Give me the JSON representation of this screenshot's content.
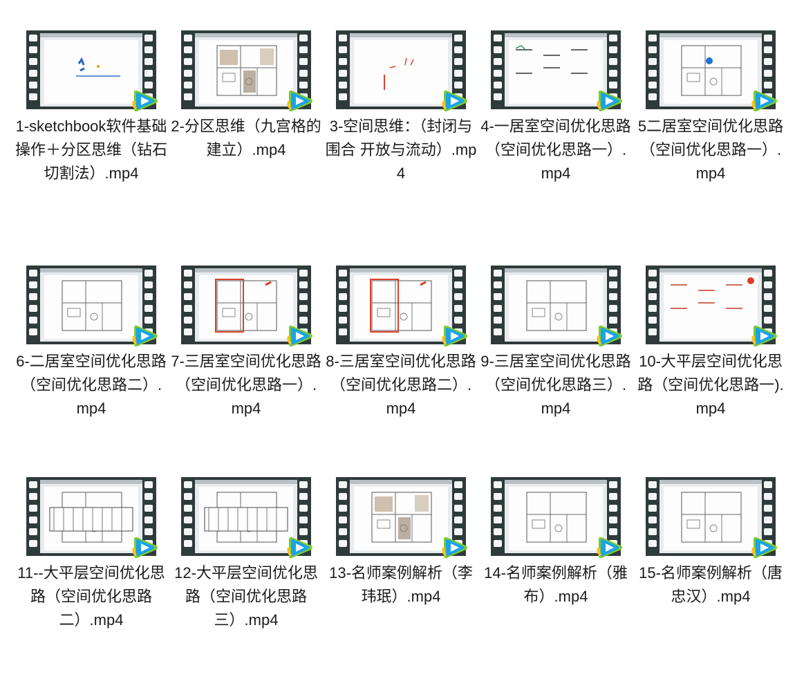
{
  "files": [
    {
      "name": "1-sketchbook软件基础操作＋分区思维（钻石切割法）.mp4",
      "thumb": "sketch"
    },
    {
      "name": "2-分区思维（九宫格的建立）.mp4",
      "thumb": "plan-color"
    },
    {
      "name": "3-空间思维：（封闭与围合 开放与流动）.mp4",
      "thumb": "sketch-red"
    },
    {
      "name": "4-一居室空间优化思路（空间优化思路一）.mp4",
      "thumb": "notes"
    },
    {
      "name": "5二居室空间优化思路（空间优化思路一）.mp4",
      "thumb": "plan-blue"
    },
    {
      "name": "6-二居室空间优化思路（空间优化思路二）.mp4",
      "thumb": "plan"
    },
    {
      "name": "7-三居室空间优化思路（空间优化思路一）.mp4",
      "thumb": "plan-red"
    },
    {
      "name": "8-三居室空间优化思路（空间优化思路二）.mp4",
      "thumb": "plan-red"
    },
    {
      "name": "9-三居室空间优化思路（空间优化思路三）.mp4",
      "thumb": "plan"
    },
    {
      "name": "10-大平层空间优化思路（空间优化思路一).mp4",
      "thumb": "notes-red"
    },
    {
      "name": "11--大平层空间优化思路（空间优化思路二）.mp4",
      "thumb": "plan-wide"
    },
    {
      "name": "12-大平层空间优化思路（空间优化思路三）.mp4",
      "thumb": "plan-wide"
    },
    {
      "name": "13-名师案例解析（李玮珉）.mp4",
      "thumb": "plan-color"
    },
    {
      "name": "14-名师案例解析（雅布）.mp4",
      "thumb": "plan"
    },
    {
      "name": "15-名师案例解析（唐忠汉）.mp4",
      "thumb": "plan"
    }
  ],
  "colors": {
    "film": "#2f3b3b",
    "badge_blue": "#1aa3e8",
    "badge_green": "#7ccb2d",
    "badge_yellow": "#f5c518"
  }
}
